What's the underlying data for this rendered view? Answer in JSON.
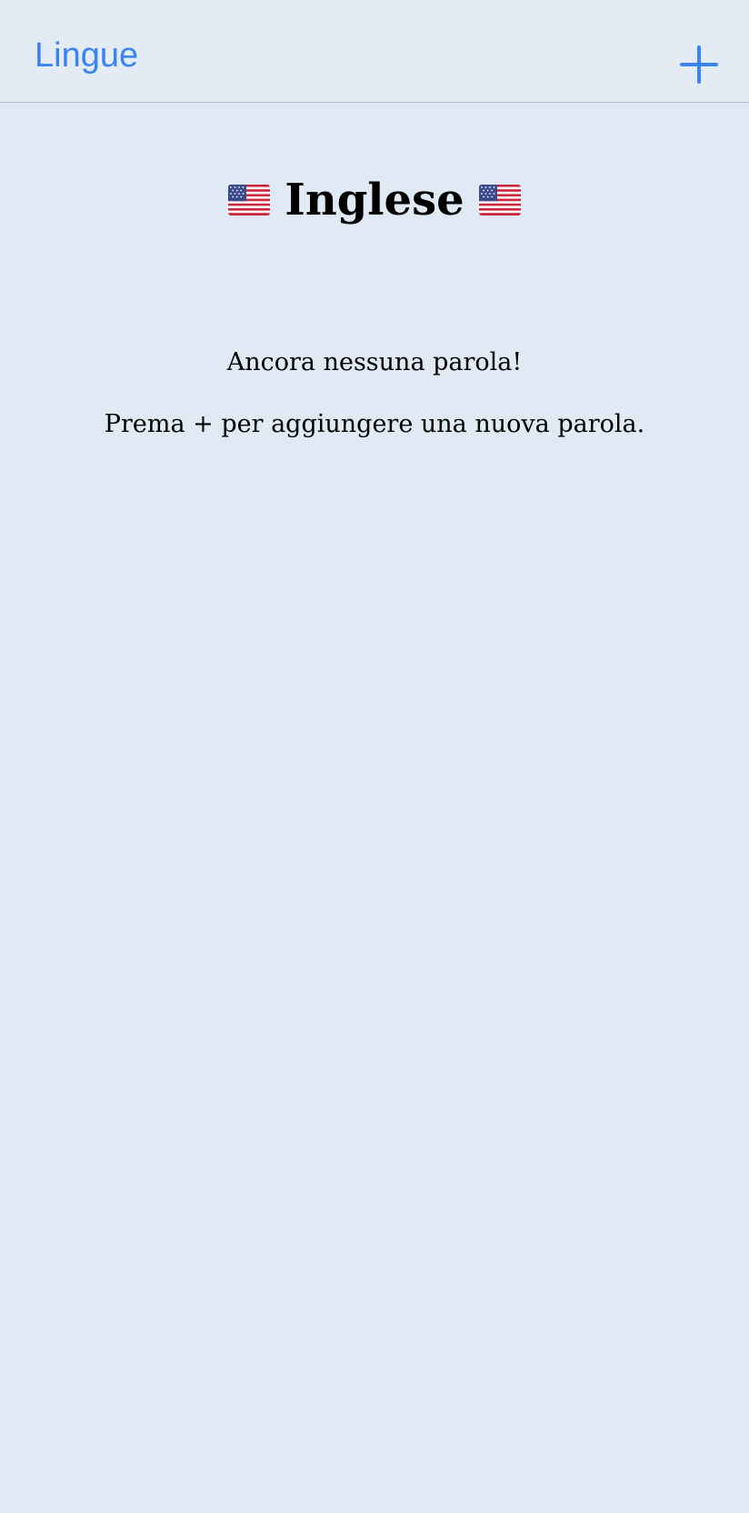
{
  "colors": {
    "accent": "#3a82f7",
    "background": "#e0eaf4",
    "nav_background": "#e3ebf5",
    "divider": "#b3bcc6",
    "text": "#000000"
  },
  "nav": {
    "back_label": "Lingue",
    "add_icon": "plus-icon"
  },
  "header": {
    "title": "Inglese",
    "left_icon": "us-flag-icon",
    "right_icon": "us-flag-icon"
  },
  "empty_state": {
    "message": "Ancora nessuna parola!",
    "hint": "Prema + per aggiungere una nuova parola."
  }
}
